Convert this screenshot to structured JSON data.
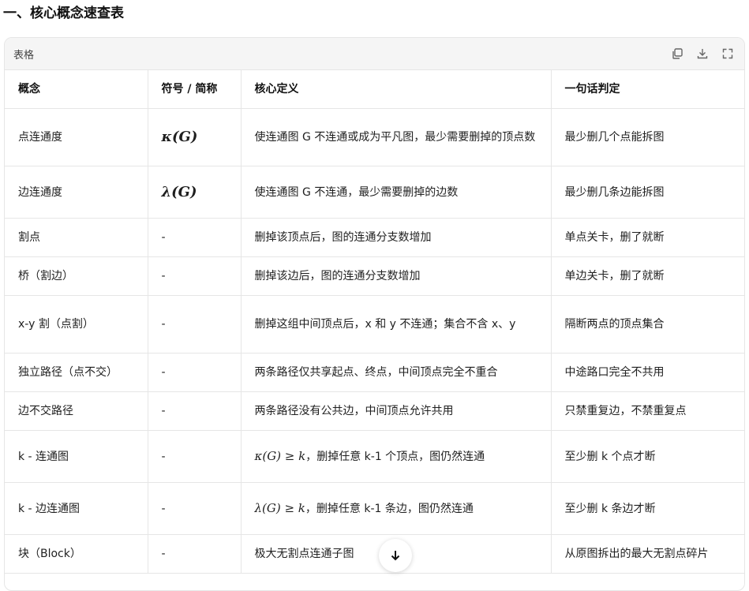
{
  "heading": "一、核心概念速查表",
  "card": {
    "title": "表格",
    "tools": [
      "copy-icon",
      "download-icon",
      "expand-icon"
    ]
  },
  "table": {
    "headers": [
      "概念",
      "符号 / 简称",
      "核心定义",
      "一句话判定"
    ],
    "rows": [
      {
        "concept": "点连通度",
        "symbol": "κ(G)",
        "definition": "使连通图 G 不连通或成为平凡图，最少需要删掉的顶点数",
        "verdict": "最少删几个点能拆图"
      },
      {
        "concept": "边连通度",
        "symbol": "λ(G)",
        "definition": "使连通图 G 不连通，最少需要删掉的边数",
        "verdict": "最少删几条边能拆图"
      },
      {
        "concept": "割点",
        "symbol": "-",
        "definition": "删掉该顶点后，图的连通分支数增加",
        "verdict": "单点关卡，删了就断"
      },
      {
        "concept": "桥（割边）",
        "symbol": "-",
        "definition": "删掉该边后，图的连通分支数增加",
        "verdict": "单边关卡，删了就断"
      },
      {
        "concept": "x-y 割（点割）",
        "symbol": "-",
        "definition": "删掉这组中间顶点后，x 和 y 不连通；集合不含 x、y",
        "verdict": "隔断两点的顶点集合"
      },
      {
        "concept": "独立路径（点不交）",
        "symbol": "-",
        "definition": "两条路径仅共享起点、终点，中间顶点完全不重合",
        "verdict": "中途路口完全不共用"
      },
      {
        "concept": "边不交路径",
        "symbol": "-",
        "definition": "两条路径没有公共边，中间顶点允许共用",
        "verdict": "只禁重复边，不禁重复点"
      },
      {
        "concept": "k - 连通图",
        "symbol": "-",
        "definition_math": "κ(G) ≥ k",
        "definition": "，删掉任意 k-1 个顶点，图仍然连通",
        "verdict": "至少删 k 个点才断"
      },
      {
        "concept": "k - 边连通图",
        "symbol": "-",
        "definition_math": "λ(G) ≥ k",
        "definition": "，删掉任意 k-1 条边，图仍然连通",
        "verdict": "至少删 k 条边才断"
      },
      {
        "concept": "块（Block）",
        "symbol": "-",
        "definition": "极大无割点连通子图",
        "verdict": "从原图拆出的最大无割点碎片"
      }
    ]
  },
  "scroll_button": {
    "icon": "arrow-down-icon"
  }
}
